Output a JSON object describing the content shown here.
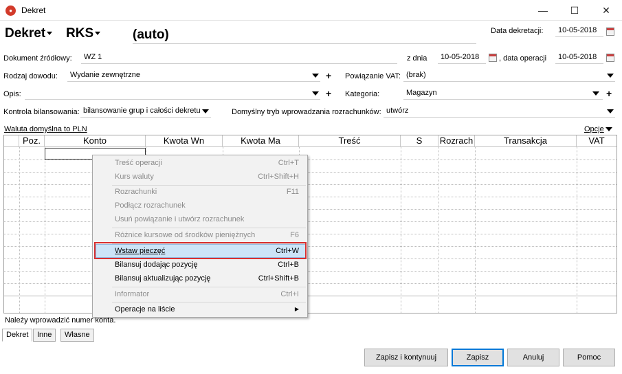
{
  "window": {
    "title": "Dekret",
    "minimize_glyph": "—",
    "maximize_glyph": "☐",
    "close_glyph": "✕"
  },
  "header": {
    "doc_type": "Dekret",
    "journal": "RKS",
    "number": "(auto)",
    "date_label": "Data dekretacji:",
    "date_value": "10-05-2018"
  },
  "form": {
    "source_doc_label": "Dokument źródłowy:",
    "source_doc_value": "WZ 1",
    "from_day_label": "z dnia",
    "from_day_value": "10-05-2018",
    "op_date_label": ", data operacji",
    "op_date_value": "10-05-2018",
    "proof_type_label": "Rodzaj dowodu:",
    "proof_type_value": "Wydanie zewnętrzne",
    "vat_link_label": "Powiązanie VAT:",
    "vat_link_value": "(brak)",
    "desc_label": "Opis:",
    "desc_value": "",
    "category_label": "Kategoria:",
    "category_value": "Magazyn",
    "balance_label": "Kontrola bilansowania:",
    "balance_value": "bilansowanie grup i całości dekretu",
    "settle_mode_label": "Domyślny tryb wprowadzania rozrachunków:",
    "settle_mode_value": "utwórz",
    "currency_link": "Waluta domyślna to PLN",
    "options_link": "Opcje",
    "plus_glyph": "+"
  },
  "grid": {
    "columns": [
      "Poz.",
      "Konto",
      "Kwota Wn",
      "Kwota Ma",
      "Treść",
      "S",
      "Rozrach",
      "Transakcja",
      "VAT"
    ]
  },
  "context_menu": {
    "items": [
      {
        "label": "Treść operacji",
        "shortcut": "Ctrl+T",
        "enabled": false
      },
      {
        "label": "Kurs waluty",
        "shortcut": "Ctrl+Shift+H",
        "enabled": false
      },
      {
        "label": "Rozrachunki",
        "shortcut": "F11",
        "enabled": false
      },
      {
        "label": "Podłącz rozrachunek",
        "shortcut": "",
        "enabled": false
      },
      {
        "label": "Usuń powiązanie i utwórz rozrachunek",
        "shortcut": "",
        "enabled": false
      },
      {
        "label": "Różnice kursowe od środków pieniężnych",
        "shortcut": "F6",
        "enabled": false
      },
      {
        "label": "Wstaw pieczęć",
        "shortcut": "Ctrl+W",
        "enabled": true,
        "highlighted": true
      },
      {
        "label": "Bilansuj dodając pozycję",
        "shortcut": "Ctrl+B",
        "enabled": true
      },
      {
        "label": "Bilansuj aktualizując pozycję",
        "shortcut": "Ctrl+Shift+B",
        "enabled": true
      },
      {
        "label": "Informator",
        "shortcut": "Ctrl+I",
        "enabled": false
      },
      {
        "label": "Operacje na liście",
        "shortcut": "",
        "enabled": true,
        "submenu": true
      }
    ],
    "submenu_glyph": "▶"
  },
  "status": {
    "message": "Należy wprowadzić numer konta."
  },
  "tabs": [
    "Dekret",
    "Inne",
    "Własne"
  ],
  "buttons": {
    "save_continue": "Zapisz i kontynuuj",
    "save": "Zapisz",
    "cancel": "Anuluj",
    "help": "Pomoc"
  },
  "colors": {
    "highlight_bg": "#cce4f7",
    "highlight_border": "#93bde3",
    "callout_red": "#d83030",
    "default_button_border": "#0078d7"
  }
}
